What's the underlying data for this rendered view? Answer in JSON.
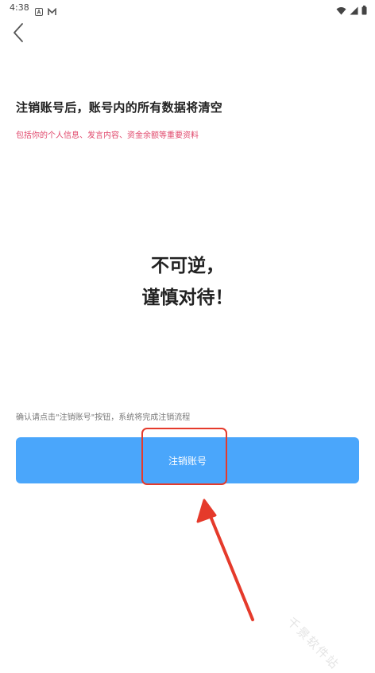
{
  "status_bar": {
    "time": "4:38"
  },
  "content": {
    "headline": "注销账号后，账号内的所有数据将清空",
    "subline": "包括你的个人信息、发言内容、资金余额等重要资料",
    "warning_line1": "不可逆，",
    "warning_line2": "谨慎对待！",
    "confirm_hint": "确认请点击\"注销账号\"按钮，系统将完成注销流程",
    "delete_button_label": "注销账号"
  },
  "watermark": {
    "text": "千景软件站"
  },
  "colors": {
    "accent_button": "#4aa6fb",
    "warning_text": "#e0466a",
    "annotation": "#e53a2b"
  }
}
